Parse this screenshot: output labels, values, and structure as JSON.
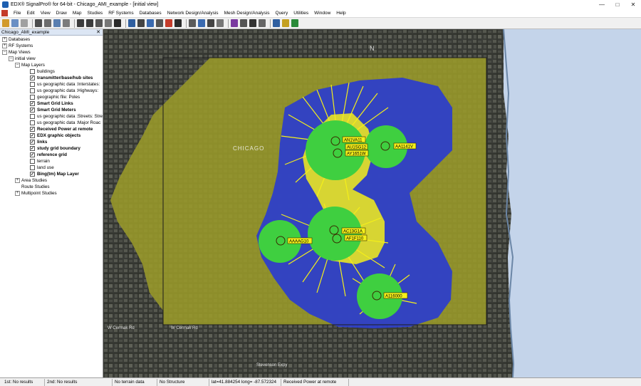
{
  "window": {
    "title": "EDX® SignalPro® for 64-bit - Chicago_AMI_example - [initial view]"
  },
  "menu": {
    "items": [
      "File",
      "Edit",
      "View",
      "Draw",
      "Map",
      "Studies",
      "RF Systems",
      "Databases",
      "Network Design/Analysis",
      "Mesh Design/Analysis",
      "Query",
      "Utilities",
      "Window",
      "Help"
    ]
  },
  "panel": {
    "title": "Chicago_AMI_example",
    "tree": {
      "databases": "Databases",
      "rf_systems": "RF Systems",
      "map_views": "Map Views",
      "initial_view": "initial view",
      "map_layers": "Map Layers",
      "layers": [
        {
          "label": "buildings",
          "checked": false,
          "bold": false
        },
        {
          "label": "transmitter/base/hub sites",
          "checked": true,
          "bold": true
        },
        {
          "label": "us geographic data :Interstates:",
          "checked": false,
          "bold": false
        },
        {
          "label": "us geographic data :Highways:",
          "checked": false,
          "bold": false
        },
        {
          "label": "geographic file: Poles",
          "checked": false,
          "bold": false
        },
        {
          "label": "Smart Grid Links",
          "checked": true,
          "bold": true
        },
        {
          "label": "Smart Grid Meters",
          "checked": true,
          "bold": true
        },
        {
          "label": "us geographic data :Streets: Stre",
          "checked": false,
          "bold": false
        },
        {
          "label": "us geographic data :Major Roac",
          "checked": false,
          "bold": false
        },
        {
          "label": "Received Power at remote",
          "checked": true,
          "bold": true
        },
        {
          "label": "EDX graphic objects",
          "checked": true,
          "bold": true
        },
        {
          "label": "links",
          "checked": true,
          "bold": true
        },
        {
          "label": "study grid boundary",
          "checked": true,
          "bold": true
        },
        {
          "label": "reference grid",
          "checked": true,
          "bold": true
        },
        {
          "label": "terrain",
          "checked": false,
          "bold": false
        },
        {
          "label": "land use",
          "checked": false,
          "bold": false
        },
        {
          "label": "Bing(tm) Map Layer",
          "checked": true,
          "bold": true
        }
      ],
      "area_studies": "Area Studies",
      "route_studies": "Route Studies",
      "multipoint_studies": "Multipoint Studies"
    }
  },
  "map": {
    "city_label": "CHICAGO",
    "north_label": "N",
    "street_labels": [
      "W Cermak Rd",
      "W Cermak Rd",
      "Stevenson Expy"
    ],
    "sites": [
      {
        "label": "AN1VA11"
      },
      {
        "label": "AU1SG12"
      },
      {
        "label": "AY1651W"
      },
      {
        "label": "AA1141V"
      },
      {
        "label": "AAAAG10"
      },
      {
        "label": "AC13G1A"
      },
      {
        "label": "AF1F110"
      },
      {
        "label": "A116000"
      }
    ],
    "colors": {
      "strong_signal": "#3fcf40",
      "links": "#f4ef1a",
      "medium_signal": "#2e3fc8",
      "weak_signal": "#9a9a2a",
      "water": "#c4d4ea"
    }
  },
  "status": {
    "cells": [
      "1st: No results",
      "2nd: No results",
      "No terrain data",
      "No Structure",
      "lat=41.884254  long= -87.572324",
      "Received Power at remote"
    ]
  }
}
